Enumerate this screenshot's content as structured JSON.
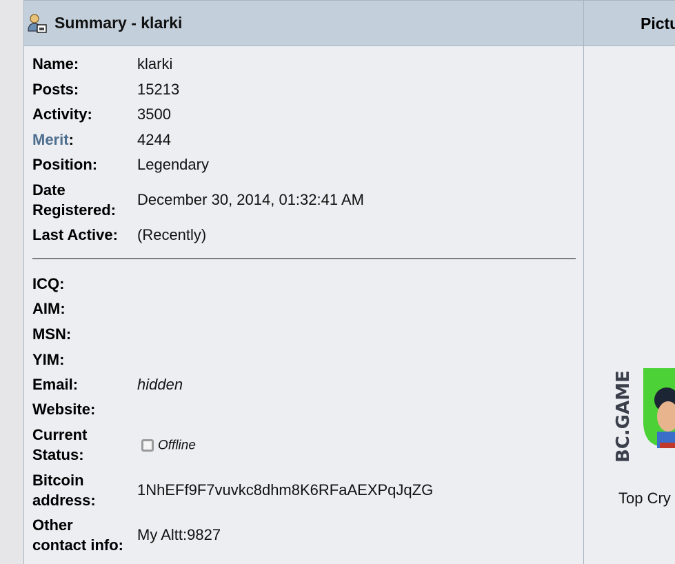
{
  "header": {
    "title": "Summary - klarki"
  },
  "profile": {
    "name": {
      "label": "Name:",
      "value": "klarki"
    },
    "posts": {
      "label": "Posts:",
      "value": "15213"
    },
    "activity": {
      "label": "Activity:",
      "value": "3500"
    },
    "merit": {
      "label_link": "Merit",
      "label_colon": ":",
      "value": "4244"
    },
    "position": {
      "label": "Position:",
      "value": "Legendary"
    },
    "date_registered": {
      "label_line1": "Date",
      "label_line2": "Registered:",
      "value": "December 30, 2014, 01:32:41 AM"
    },
    "last_active": {
      "label": "Last Active:",
      "value": "(Recently)"
    }
  },
  "contact": {
    "icq": {
      "label": "ICQ:",
      "value": ""
    },
    "aim": {
      "label": "AIM:",
      "value": ""
    },
    "msn": {
      "label": "MSN:",
      "value": ""
    },
    "yim": {
      "label": "YIM:",
      "value": ""
    },
    "email": {
      "label": "Email:",
      "value": "hidden"
    },
    "website": {
      "label": "Website:",
      "value": ""
    },
    "current_status": {
      "label_line1": "Current",
      "label_line2": "Status:",
      "value": "Offline"
    },
    "bitcoin_address": {
      "label_line1": "Bitcoin",
      "label_line2": "address:",
      "value": "1NhEFf9F7vuvkc8dhm8K6RFaAEXPqJqZG"
    },
    "other_contact": {
      "label_line1": "Other",
      "label_line2": "contact info:",
      "value": "My Altt:9827"
    }
  },
  "picture": {
    "header": "Picture",
    "avatar_brand": "BC.GAME",
    "caption": "Top Cry"
  },
  "colors": {
    "header_bg": "#c3d0db",
    "panel_bg": "#eceef2",
    "merit_link": "#4d6e8e",
    "brand_green": "#4cd137"
  },
  "icons": {
    "header": "user-summary-icon",
    "status": "offline-status-icon"
  }
}
